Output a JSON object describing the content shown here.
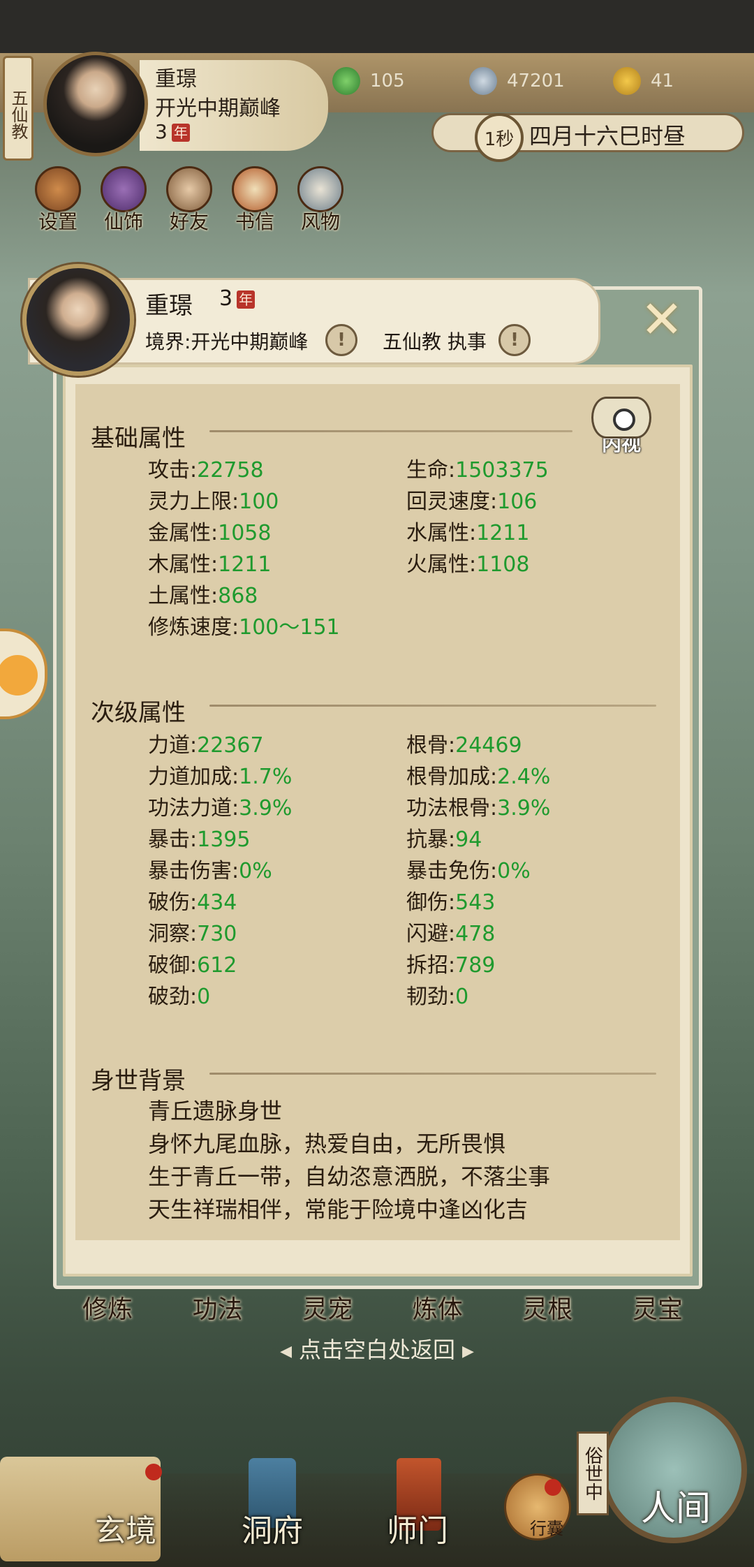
{
  "hud": {
    "sect_tab": "五仙教",
    "name": "重璟",
    "realm": "开光中期巅峰",
    "age": "3",
    "age_unit": "年",
    "resources": [
      {
        "icon": "jade-leaf-icon",
        "value": "105"
      },
      {
        "icon": "coin-icon",
        "value": "47201"
      },
      {
        "icon": "merit-icon",
        "value": "41"
      }
    ],
    "time_speed": "1秒",
    "time_text": "四月十六巳时昼",
    "menu": [
      {
        "icon": "settings-icon",
        "label": "设置"
      },
      {
        "icon": "fairy-dress-icon",
        "label": "仙饰"
      },
      {
        "icon": "friends-icon",
        "label": "好友"
      },
      {
        "icon": "letter-icon",
        "label": "书信"
      },
      {
        "icon": "customs-icon",
        "label": "风物"
      }
    ]
  },
  "character": {
    "name": "重璟",
    "age": "3",
    "age_unit": "年",
    "realm_label": "境界:开光中期巅峰",
    "sect_label": "五仙教 执事",
    "inner_view_label": "内视"
  },
  "basic": {
    "title": "基础属性",
    "left": [
      {
        "k": "攻击",
        "v": "22758"
      },
      {
        "k": "灵力上限",
        "v": "100"
      },
      {
        "k": "金属性",
        "v": "1058"
      },
      {
        "k": "木属性",
        "v": "1211"
      },
      {
        "k": "土属性",
        "v": "868"
      },
      {
        "k": "修炼速度",
        "v": "100～151"
      }
    ],
    "right": [
      {
        "k": "生命",
        "v": "1503375"
      },
      {
        "k": "回灵速度",
        "v": "106"
      },
      {
        "k": "水属性",
        "v": "1211"
      },
      {
        "k": "火属性",
        "v": "1108"
      }
    ]
  },
  "secondary": {
    "title": "次级属性",
    "left": [
      {
        "k": "力道",
        "v": "22367"
      },
      {
        "k": "力道加成",
        "v": "1.7%"
      },
      {
        "k": "功法力道",
        "v": "3.9%"
      },
      {
        "k": "暴击",
        "v": "1395"
      },
      {
        "k": "暴击伤害",
        "v": "0%"
      },
      {
        "k": "破伤",
        "v": "434"
      },
      {
        "k": "洞察",
        "v": "730"
      },
      {
        "k": "破御",
        "v": "612"
      },
      {
        "k": "破劲",
        "v": "0"
      }
    ],
    "right": [
      {
        "k": "根骨",
        "v": "24469"
      },
      {
        "k": "根骨加成",
        "v": "2.4%"
      },
      {
        "k": "功法根骨",
        "v": "3.9%"
      },
      {
        "k": "抗暴",
        "v": "94"
      },
      {
        "k": "暴击免伤",
        "v": "0%"
      },
      {
        "k": "御伤",
        "v": "543"
      },
      {
        "k": "闪避",
        "v": "478"
      },
      {
        "k": "拆招",
        "v": "789"
      },
      {
        "k": "韧劲",
        "v": "0"
      }
    ]
  },
  "background": {
    "title": "身世背景",
    "lines": [
      "青丘遗脉身世",
      "身怀九尾血脉，热爱自由，无所畏惧",
      "生于青丘一带，自幼恣意洒脱，不落尘事",
      "天生祥瑞相伴，常能于险境中逢凶化吉"
    ]
  },
  "tabs": [
    "修炼",
    "功法",
    "灵宠",
    "炼体",
    "灵根",
    "灵宝"
  ],
  "return_hint": "点击空白处返回",
  "nav": {
    "items": [
      "玄境",
      "洞府",
      "师门"
    ],
    "pouch": "行囊",
    "world_tag": "俗世中",
    "world": "人间"
  }
}
